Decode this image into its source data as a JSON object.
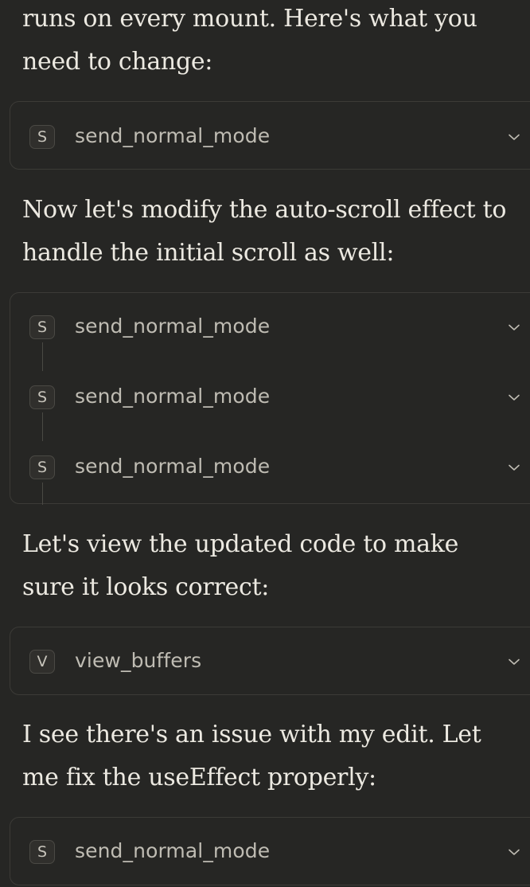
{
  "paragraphs": [
    {
      "lines": [
        "runs on every mount. Here's what you",
        "need to change:"
      ]
    },
    {
      "lines": [
        "Now let's modify the auto-scroll effect to",
        "handle the initial scroll as well:"
      ]
    },
    {
      "lines": [
        "Let's view the updated code to make",
        "sure it looks correct:"
      ]
    },
    {
      "lines": [
        "I see there's an issue with my edit. Let",
        "me fix the useEffect properly:"
      ]
    }
  ],
  "tool_cards": [
    {
      "items": [
        {
          "badge": "S",
          "name": "send_normal_mode",
          "icon": "chevron-down-icon"
        }
      ]
    },
    {
      "items": [
        {
          "badge": "S",
          "name": "send_normal_mode",
          "icon": "chevron-down-icon"
        },
        {
          "badge": "S",
          "name": "send_normal_mode",
          "icon": "chevron-down-icon"
        },
        {
          "badge": "S",
          "name": "send_normal_mode",
          "icon": "chevron-down-icon"
        }
      ]
    },
    {
      "items": [
        {
          "badge": "V",
          "name": "view_buffers",
          "icon": "chevron-down-icon"
        }
      ]
    },
    {
      "items": [
        {
          "badge": "S",
          "name": "send_normal_mode",
          "icon": "chevron-down-icon"
        }
      ]
    }
  ],
  "colors": {
    "background": "#262624",
    "text": "#ece9e1",
    "card_border": "#3c3b37",
    "muted_text": "#bfbcb3"
  }
}
